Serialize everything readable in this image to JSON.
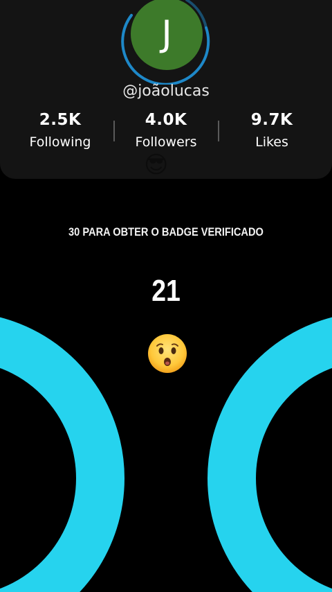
{
  "profile": {
    "avatar_letter": "J",
    "avatar_color": "#3d7a2a",
    "ring_color": "#1e88c8",
    "username": "@joãolucas",
    "stats": [
      {
        "value": "2.5K",
        "label": "Following"
      },
      {
        "value": "4.0K",
        "label": "Followers"
      },
      {
        "value": "9.7K",
        "label": "Likes"
      }
    ],
    "faded_emoji": "😎"
  },
  "goal": {
    "text": "30 PARA OBTER O BADGE VERIFICADO",
    "counter": "21",
    "emoji": "surprised-face-emoji"
  },
  "accent_color": "#26d3ee"
}
